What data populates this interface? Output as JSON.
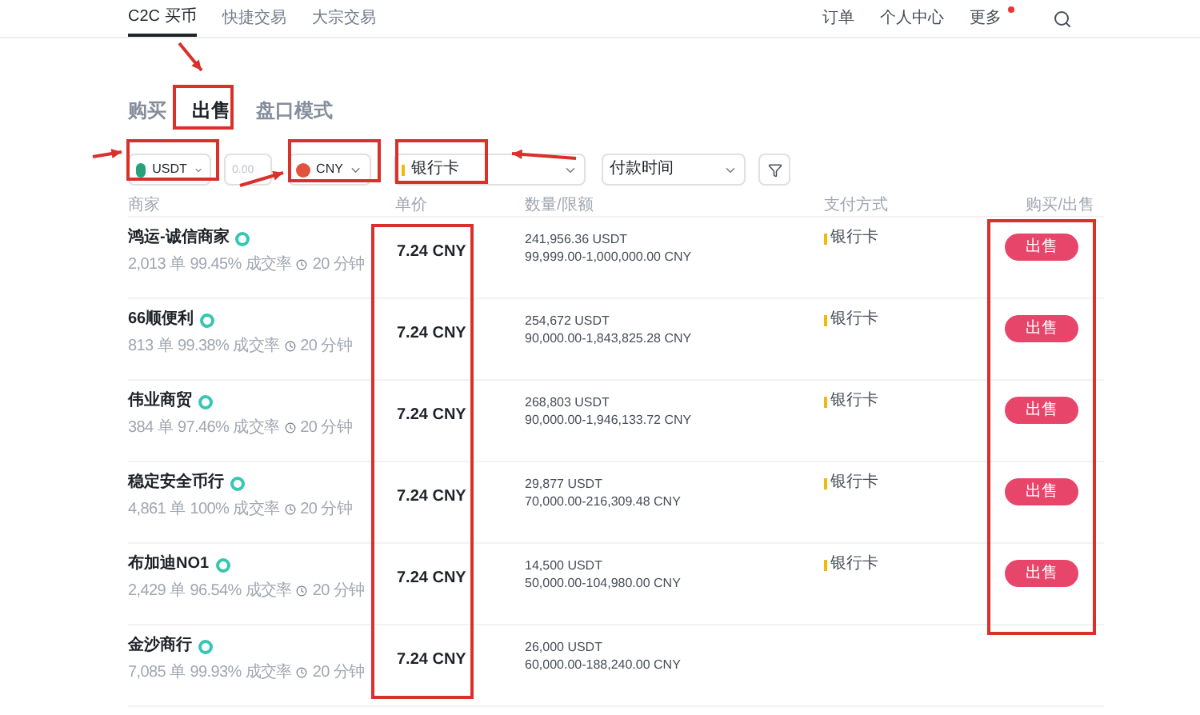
{
  "nav": {
    "items": [
      {
        "label": "C2C 买币",
        "selected": true
      },
      {
        "label": "快捷交易",
        "selected": false
      },
      {
        "label": "大宗交易",
        "selected": false
      }
    ],
    "right": [
      "订单",
      "个人中心"
    ],
    "more": {
      "label": "更多",
      "badge": true
    }
  },
  "mode_tabs": [
    {
      "label": "购买",
      "selected": false
    },
    {
      "label": "出售",
      "selected": true
    },
    {
      "label": "盘口模式",
      "selected": false
    }
  ],
  "filters": {
    "coin": "USDT",
    "amount_placeholder": "0.00",
    "fiat": "CNY",
    "payment": "银行卡",
    "payment_time": "付款时间"
  },
  "table": {
    "columns": [
      "商家",
      "单价",
      "数量/限额",
      "支付方式",
      "购买/出售"
    ],
    "rows": [
      {
        "name": "鸿运-诚信商家",
        "orders": "2,013 单",
        "rate": "99.45% 成交率",
        "time": "20 分钟",
        "price": "7.24 CNY",
        "amount": "241,956.36 USDT",
        "limit": "99,999.00-1,000,000.00 CNY",
        "payment": "银行卡",
        "action": "出售"
      },
      {
        "name": "66顺便利",
        "orders": "813 单",
        "rate": "99.38% 成交率",
        "time": "20 分钟",
        "price": "7.24 CNY",
        "amount": "254,672 USDT",
        "limit": "90,000.00-1,843,825.28 CNY",
        "payment": "银行卡",
        "action": "出售"
      },
      {
        "name": "伟业商贸",
        "orders": "384 单",
        "rate": "97.46% 成交率",
        "time": "20 分钟",
        "price": "7.24 CNY",
        "amount": "268,803 USDT",
        "limit": "90,000.00-1,946,133.72 CNY",
        "payment": "银行卡",
        "action": "出售"
      },
      {
        "name": "稳定安全币行",
        "orders": "4,861 单",
        "rate": "100% 成交率",
        "time": "20 分钟",
        "price": "7.24 CNY",
        "amount": "29,877 USDT",
        "limit": "70,000.00-216,309.48 CNY",
        "payment": "银行卡",
        "action": "出售"
      },
      {
        "name": "布加迪NO1",
        "orders": "2,429 单",
        "rate": "96.54% 成交率",
        "time": "20 分钟",
        "price": "7.24 CNY",
        "amount": "14,500 USDT",
        "limit": "50,000.00-104,980.00 CNY",
        "payment": "银行卡",
        "action": "出售"
      },
      {
        "name": "金沙商行",
        "orders": "7,085 单",
        "rate": "99.93% 成交率",
        "time": "20 分钟",
        "price": "7.24 CNY",
        "amount": "26,000 USDT",
        "limit": "60,000.00-188,240.00 CNY"
      }
    ]
  }
}
